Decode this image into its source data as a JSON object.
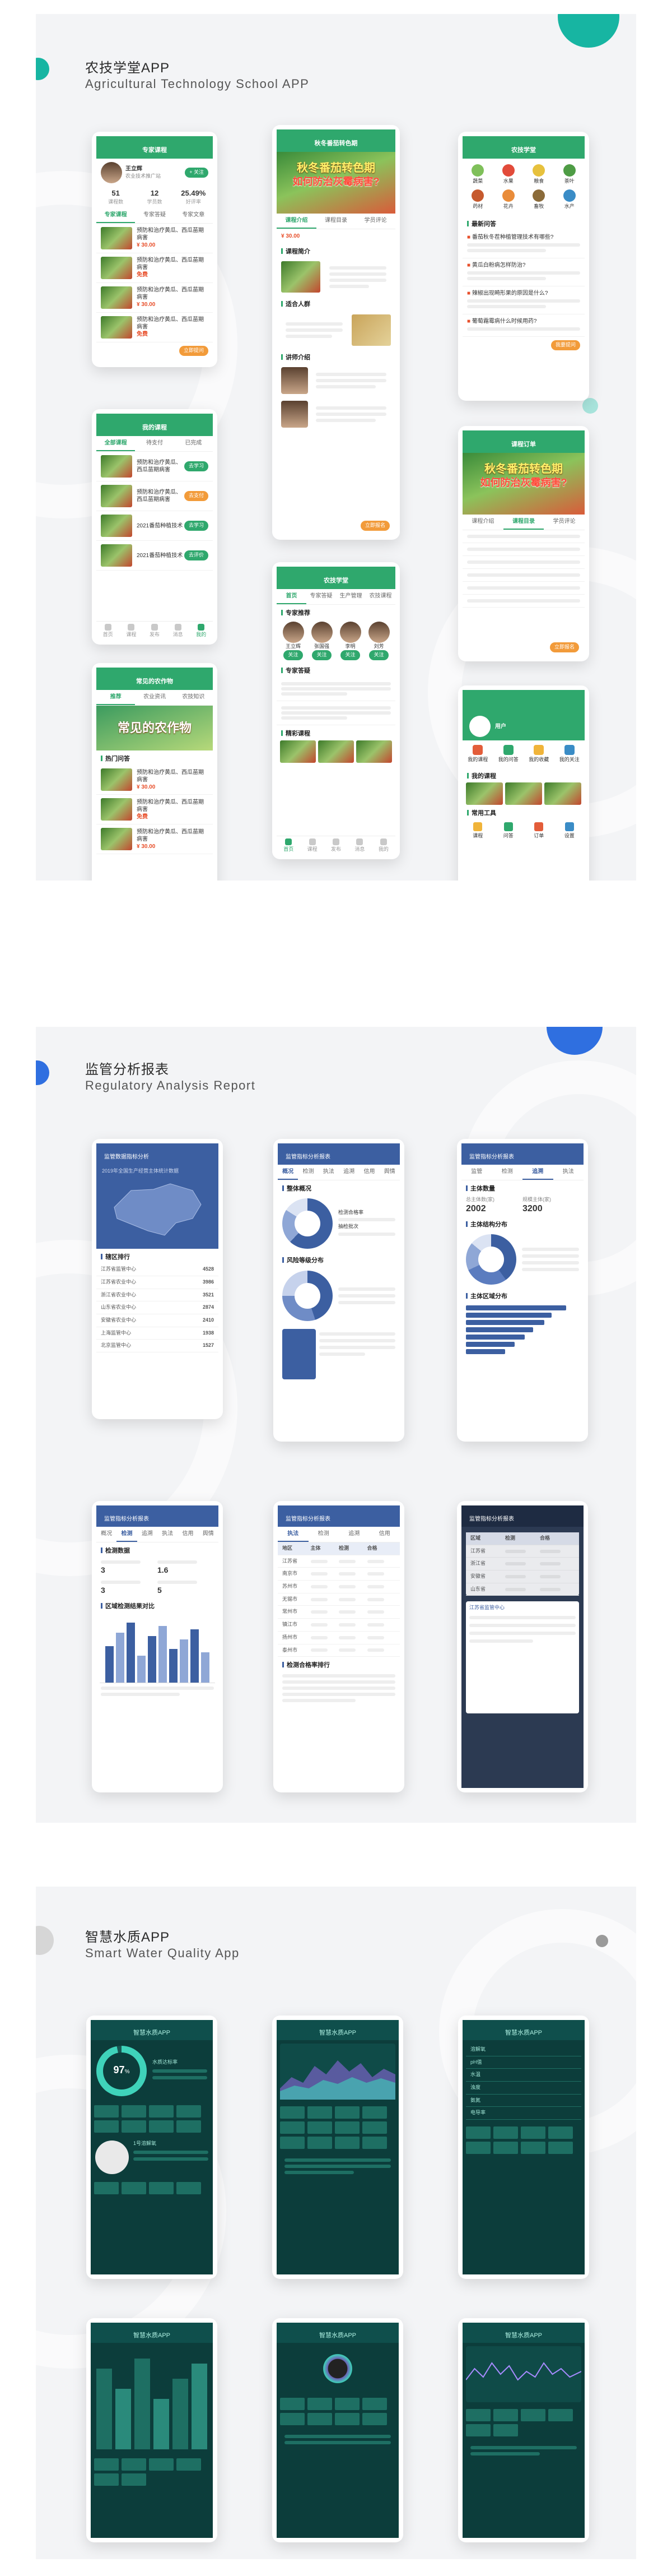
{
  "sections": [
    {
      "title": "农技学堂APP",
      "subtitle": "Agricultural Technology School APP"
    },
    {
      "title": "监管分析报表",
      "subtitle": "Regulatory Analysis Report"
    },
    {
      "title": "智慧水质APP",
      "subtitle": "Smart Water Quality App"
    }
  ],
  "colors": {
    "green": "#2fa86d",
    "blue": "#3c5fa1",
    "teal": "#0f4f4c",
    "accent": "#17b5a2"
  },
  "agri": {
    "p1": {
      "title": "专家课程",
      "name": "王立辉",
      "org": "农业技术推广站",
      "badge": "+ 关注",
      "stats": [
        "51",
        "12",
        "25.49%"
      ],
      "stat_labels": [
        "课程数",
        "学员数",
        "好评率"
      ],
      "tabs": [
        "专家课程",
        "专家答疑",
        "专家文章"
      ],
      "items": [
        "预防和治疗黄瓜、西瓜苗期病害",
        "预防和治疗黄瓜、西瓜苗期病害",
        "预防和治疗黄瓜、西瓜苗期病害",
        "预防和治疗黄瓜、西瓜苗期病害"
      ],
      "prices": [
        "¥ 30.00",
        "免费",
        "¥ 30.00",
        "免费"
      ],
      "cta": "立即提问"
    },
    "p2": {
      "title": "秋冬番茄转色期",
      "banner_1": "秋冬番茄转色期",
      "banner_2": "如何防治灰霉病害?",
      "tabs": [
        "课程介绍",
        "课程目录",
        "学员评论"
      ],
      "price": "¥ 30.00",
      "sections": [
        "课程简介",
        "适合人群",
        "讲师介绍"
      ],
      "cta": "立即报名"
    },
    "p3": {
      "title": "农技学堂",
      "cats": [
        "蔬菜",
        "水果",
        "粮食",
        "茶叶",
        "药材",
        "花卉",
        "畜牧",
        "水产"
      ],
      "q_title": "最新问答",
      "questions": [
        "番茄秋冬茬种植管理技术有哪些?",
        "黄瓜白粉病怎样防治?",
        "辣椒出现畸形果的原因是什么?",
        "葡萄霜霉病什么时候用药?"
      ],
      "cta": "我要提问"
    },
    "p4": {
      "title": "我的课程",
      "tabs": [
        "全部课程",
        "待支付",
        "已完成"
      ],
      "items": [
        "预防和治疗黄瓜、西瓜苗期病害",
        "预防和治疗黄瓜、西瓜苗期病害",
        "2021番茄种植技术",
        "2021番茄种植技术"
      ],
      "btns": [
        "去学习",
        "去支付",
        "去学习",
        "去评价"
      ]
    },
    "p5": {
      "title": "农技学堂",
      "tabs": [
        "首页",
        "专家答疑",
        "生产管理",
        "农技课程"
      ],
      "sections": [
        "专家推荐",
        "专家答疑",
        "精彩课程"
      ],
      "experts": [
        "王立辉",
        "张国强",
        "李明",
        "刘芳"
      ],
      "follow": "关注"
    },
    "p6": {
      "title": "课程订单",
      "banner_1": "秋冬番茄转色期",
      "banner_2": "如何防治灰霉病害?",
      "tabs": [
        "课程介绍",
        "课程目录",
        "学员评论"
      ],
      "cta": "立即报名"
    },
    "p7": {
      "title": "常见的农作物",
      "tabs": [
        "推荐",
        "农业资讯",
        "农技知识"
      ],
      "banner": "常见的农作物",
      "section": "热门问答",
      "items": [
        "预防和治疗黄瓜、西瓜苗期病害",
        "预防和治疗黄瓜、西瓜苗期病害",
        "预防和治疗黄瓜、西瓜苗期病害"
      ],
      "prices": [
        "¥ 30.00",
        "免费",
        "¥ 30.00"
      ]
    },
    "p8": {
      "title": "我的",
      "user": "用户",
      "menu": [
        "我的课程",
        "我的问答",
        "我的收藏",
        "我的关注"
      ],
      "sections": [
        "我的课程",
        "常用工具"
      ],
      "tools": [
        "课程",
        "问答",
        "订单",
        "设置"
      ]
    },
    "nav": [
      "首页",
      "课程",
      "发布",
      "消息",
      "我的"
    ]
  },
  "reg": {
    "r1": {
      "title": "监管数据指标分析",
      "sub": "2019年全国生产经营主体统计数据",
      "list": [
        "江苏省监管中心",
        "江苏省农业中心",
        "浙江省农业中心",
        "山东省农业中心",
        "安徽省农业中心",
        "上海监管中心",
        "北京监管中心"
      ],
      "values": [
        "4528",
        "3986",
        "3521",
        "2874",
        "2410",
        "1938",
        "1527"
      ],
      "rank": "辖区排行"
    },
    "r2": {
      "title": "监管指标分析报表",
      "tabs": [
        "概况",
        "检测",
        "执法",
        "追溯",
        "信用",
        "舆情"
      ],
      "h1": "整体概况",
      "stat_1": "检测合格率",
      "stat_2": "抽检批次",
      "section": "风险等级分布"
    },
    "r3": {
      "title": "监管指标分析报表",
      "tabs": [
        "监管",
        "检测",
        "追溯",
        "执法"
      ],
      "h": "主体数量",
      "v1": "2002",
      "v2": "3200",
      "l1": "总主体数(家)",
      "l2": "规模主体(家)",
      "s2": "主体结构分布",
      "s3": "主体区域分布"
    },
    "r4": {
      "title": "监管指标分析报表",
      "tabs": [
        "概况",
        "检测",
        "追溯",
        "执法",
        "信用",
        "舆情"
      ],
      "h": "检测数据",
      "values": [
        "3",
        "1.6",
        "3",
        "5"
      ],
      "s2": "区域检测结果对比"
    },
    "r5": {
      "title": "监管指标分析报表",
      "tabs": [
        "执法",
        "检测",
        "追溯",
        "信用"
      ],
      "cols": [
        "地区",
        "主体",
        "检测",
        "合格"
      ],
      "rows": [
        "江苏省",
        "南京市",
        "苏州市",
        "无锡市",
        "常州市",
        "镇江市",
        "扬州市",
        "泰州市"
      ],
      "s2": "检测合格率排行"
    },
    "r6": {
      "title": "监管指标分析报表",
      "cols": [
        "区域",
        "检测",
        "合格"
      ],
      "rows": [
        "江苏省",
        "浙江省",
        "安徽省",
        "山东省"
      ],
      "foot": "江苏省监管中心"
    }
  },
  "water": {
    "w": {
      "title": "智慧水质APP",
      "value": "97",
      "unit": "%",
      "label": "水质达标率",
      "sensor": "1号溶解氧",
      "list": [
        "溶解氧",
        "pH值",
        "水温",
        "浊度",
        "氨氮",
        "电导率"
      ]
    }
  }
}
